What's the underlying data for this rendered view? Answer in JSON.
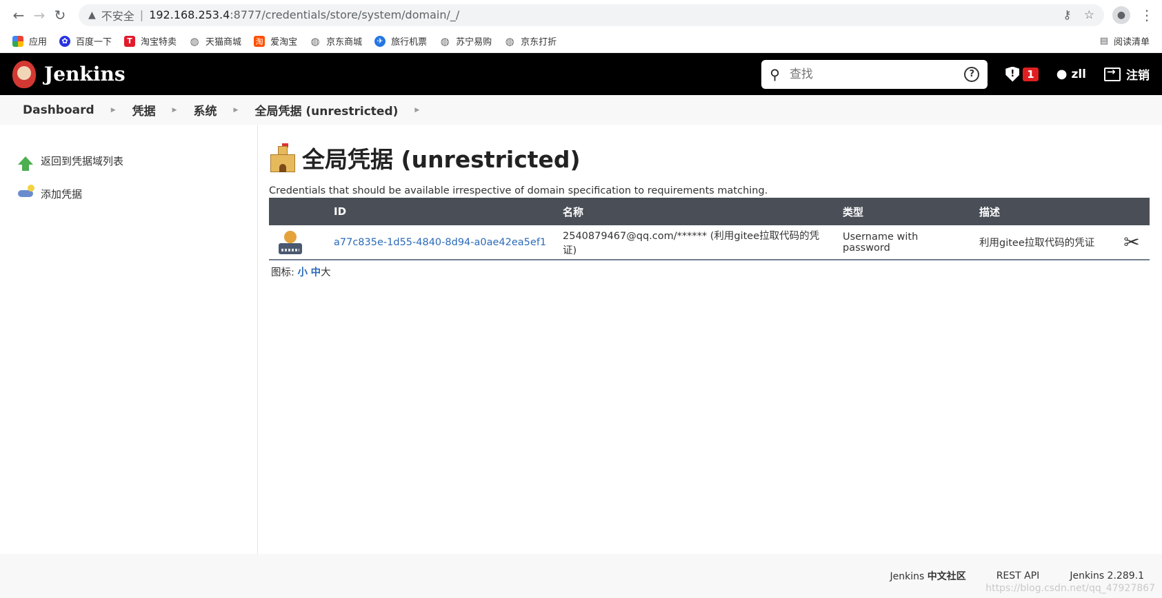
{
  "browser": {
    "insecure_label": "不安全",
    "url_host": "192.168.253.4",
    "url_path": ":8777/credentials/store/system/domain/_/",
    "bookmarks": [
      {
        "label": "应用",
        "icon": "apps-grid-icon",
        "color": "#4285f4"
      },
      {
        "label": "百度一下",
        "icon": "baidu-paw-icon",
        "color": "#2932e1"
      },
      {
        "label": "淘宝特卖",
        "icon": "tmall-t-icon",
        "color": "#e21b2c"
      },
      {
        "label": "天猫商城",
        "icon": "globe-icon",
        "color": "#666666"
      },
      {
        "label": "爱淘宝",
        "icon": "taobao-icon",
        "color": "#ff5000"
      },
      {
        "label": "京东商城",
        "icon": "globe-icon",
        "color": "#666666"
      },
      {
        "label": "旅行机票",
        "icon": "travel-icon",
        "color": "#2577e3"
      },
      {
        "label": "苏宁易购",
        "icon": "globe-icon",
        "color": "#666666"
      },
      {
        "label": "京东打折",
        "icon": "globe-icon",
        "color": "#666666"
      }
    ],
    "reading_list": "阅读清单"
  },
  "header": {
    "brand": "Jenkins",
    "search_placeholder": "查找",
    "security_count": "1",
    "user": "zll",
    "logout": "注销"
  },
  "breadcrumb": [
    "Dashboard",
    "凭据",
    "系统",
    "全局凭据 (unrestricted)"
  ],
  "sidebar": {
    "items": [
      {
        "label": "返回到凭据域列表",
        "icon": "up-arrow-icon"
      },
      {
        "label": "添加凭据",
        "icon": "key-icon"
      }
    ]
  },
  "main": {
    "title": "全局凭据 (unrestricted)",
    "description": "Credentials that should be available irrespective of domain specification to requirements matching.",
    "columns": [
      "ID",
      "名称",
      "类型",
      "描述"
    ],
    "rows": [
      {
        "id": "a77c835e-1d55-4840-8d94-a0ae42ea5ef1",
        "name": "2540879467@qq.com/****** (利用gitee拉取代码的凭证)",
        "type": "Username with password",
        "description": "利用gitee拉取代码的凭证"
      }
    ],
    "icon_size_label": "图标:",
    "icon_sizes": [
      "小",
      "中",
      "大"
    ]
  },
  "footer": {
    "community_prefix": "Jenkins",
    "community": "中文社区",
    "rest_api": "REST API",
    "version": "Jenkins 2.289.1"
  },
  "watermark": "https://blog.csdn.net/qq_47927867",
  "colors": {
    "header_bg": "#000000",
    "table_header": "#4a4f57",
    "link": "#2a6ab8",
    "badge": "#e02020"
  }
}
